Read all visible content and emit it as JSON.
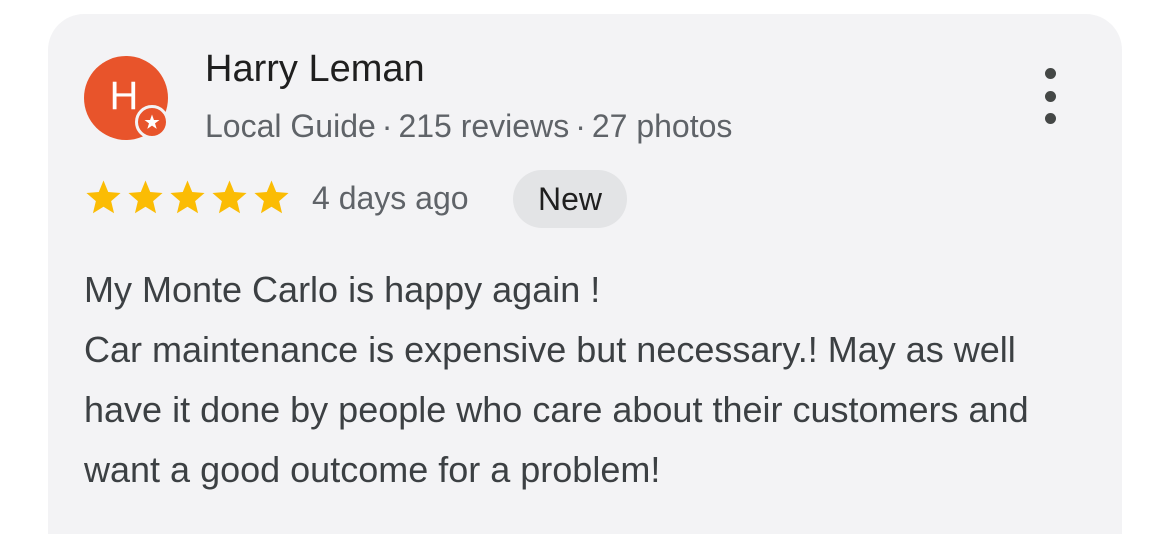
{
  "reviewer": {
    "name": "Harry Leman",
    "avatar_initial": "H",
    "avatar_color": "#e8542b",
    "badge_icon": "local-guide-star-icon",
    "role": "Local Guide",
    "reviews_count": "215 reviews",
    "photos_count": "27 photos",
    "separator": "·"
  },
  "rating": {
    "stars": 5,
    "max_stars": 5,
    "star_color": "#fbbc04",
    "icon": "star-icon"
  },
  "date": "4 days ago",
  "badge": "New",
  "menu_icon": "more-vert-icon",
  "review_text": {
    "line1": "My Monte Carlo is happy again !",
    "line2": "Car maintenance is expensive but necessary.! May as well have it done by people who care about their customers and want a good outcome for a problem!"
  },
  "colors": {
    "card_background": "#f3f3f5",
    "badge_background": "#e3e4e6"
  }
}
